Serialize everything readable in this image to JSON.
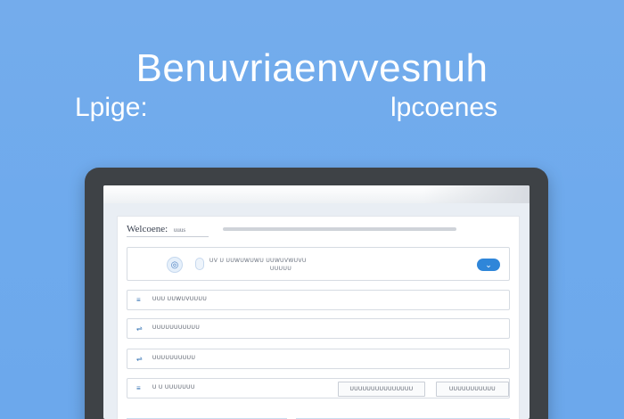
{
  "hero": {
    "title": "Benuvriaenvvesnuh",
    "subtitle_left": "Lpige:",
    "subtitle_right": "lpcoenes"
  },
  "app": {
    "header_title": "Welcoene:",
    "header_suffix": "uuus",
    "main_card": {
      "line1": "UV U UUWUWUWU UUWUVWUVU",
      "line2": "UUUUU",
      "icon_glyph": "◎",
      "toggle_glyph": "⌄"
    },
    "rows": [
      {
        "icon": "≡",
        "label": "UUU UUWUVUUUU"
      },
      {
        "icon": "⇌",
        "label": "UUUUUUUUUUU"
      },
      {
        "icon": "⇌",
        "label": "UUUUUUUUUU"
      },
      {
        "icon": "≡",
        "label": "U U UUUUUUU",
        "buttons": [
          "UUUUUUUUUUUUUUU",
          "UUUUUUUUUUU"
        ]
      }
    ]
  },
  "colors": {
    "background": "#6eaaed",
    "accent": "#2f86d9",
    "device_frame": "#3e4246"
  }
}
